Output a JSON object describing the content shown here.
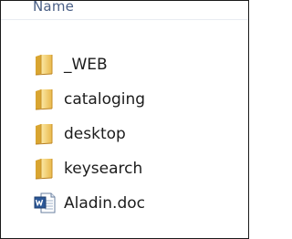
{
  "explorer": {
    "column_header": "Name",
    "items": [
      {
        "label": "_WEB",
        "type": "folder",
        "icon": "folder-icon"
      },
      {
        "label": "cataloging",
        "type": "folder",
        "icon": "folder-icon"
      },
      {
        "label": "desktop",
        "type": "folder",
        "icon": "folder-icon"
      },
      {
        "label": "keysearch",
        "type": "folder",
        "icon": "folder-icon"
      },
      {
        "label": "Aladin.doc",
        "type": "word-document",
        "icon": "word-document-icon"
      }
    ]
  },
  "colors": {
    "header_text": "#4a5f86",
    "item_text": "#1c1c1c",
    "folder_light": "#f7dc7c",
    "folder_dark": "#d9a531",
    "word_blue": "#2b5797"
  }
}
